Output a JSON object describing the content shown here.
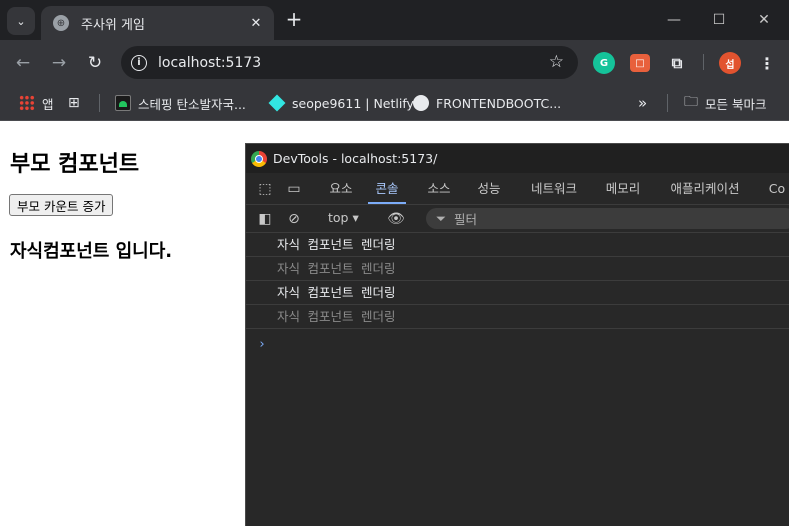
{
  "browser": {
    "tab": {
      "title": "주사위 게임",
      "close": "✕"
    },
    "new_tab": "+",
    "window_controls": {
      "minimize": "—",
      "maximize": "☐",
      "close": "✕"
    },
    "nav": {
      "back": "←",
      "forward": "→",
      "reload": "↻"
    },
    "address": "localhost:5173",
    "profile_initial": "섭",
    "bookmarks": [
      {
        "label": "앱"
      },
      {
        "label": "스테핑 탄소발자국..."
      },
      {
        "label": "seope9611 | Netlify"
      },
      {
        "label": "FRONTENDBOOTC..."
      }
    ],
    "bookmarks_overflow": "»",
    "all_bookmarks": "모든 북마크"
  },
  "page": {
    "parent_title": "부모 컴포넌트",
    "increase_button": "부모 카운트 증가",
    "child_title": "자식컴포넌트 입니다."
  },
  "devtools": {
    "title": "DevTools - localhost:5173/",
    "tabs": [
      "요소",
      "콘솔",
      "소스",
      "성능",
      "네트워크",
      "메모리",
      "애플리케이션",
      "Co"
    ],
    "active_tab": "콘솔",
    "context": "top ▾",
    "filter_placeholder": "필터",
    "console_lines": [
      "자식 컴포넌트 렌더링",
      "자식 컴포넌트 렌더링",
      "자식 컴포넌트 렌더링",
      "자식 컴포넌트 렌더링"
    ],
    "prompt": "›"
  }
}
